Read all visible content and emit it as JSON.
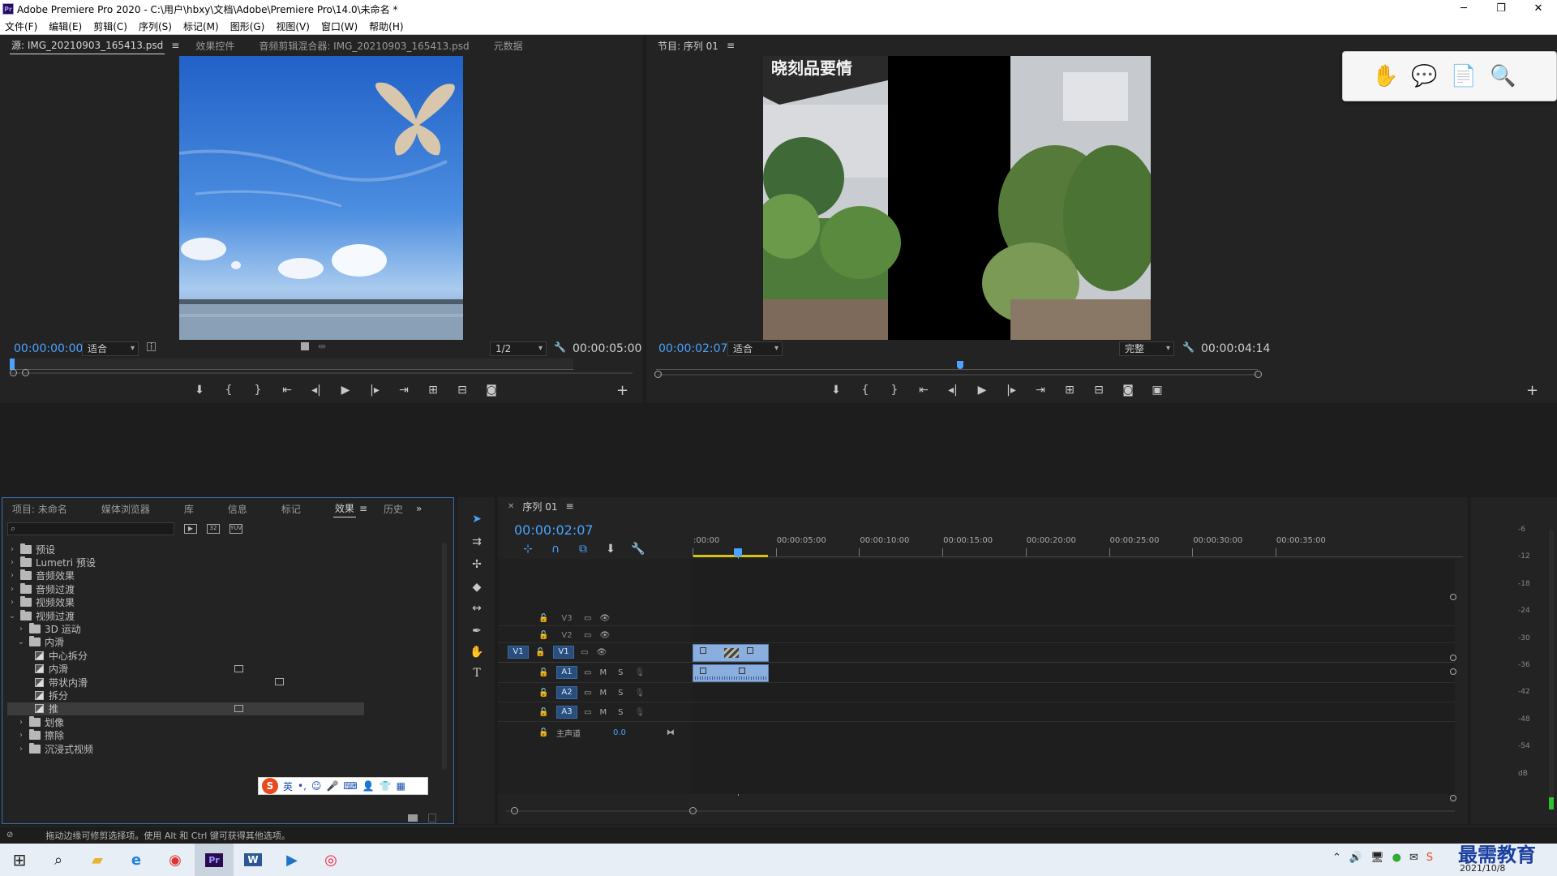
{
  "window": {
    "title": "Adobe Premiere Pro 2020 - C:\\用户\\hbxy\\文档\\Adobe\\Premiere Pro\\14.0\\未命名 *",
    "logo": "Pr"
  },
  "menu": [
    "文件(F)",
    "编辑(E)",
    "剪辑(C)",
    "序列(S)",
    "标记(M)",
    "图形(G)",
    "视图(V)",
    "窗口(W)",
    "帮助(H)"
  ],
  "source_panel": {
    "tabs": [
      "源: IMG_20210903_165413.psd",
      "效果控件",
      "音频剪辑混合器: IMG_20210903_165413.psd",
      "元数据"
    ],
    "timecode_in": "00:00:00:00",
    "fit": "适合",
    "resolution": "1/2",
    "duration": "00:00:05:00"
  },
  "program_panel": {
    "tab": "节目: 序列 01",
    "timecode": "00:00:02:07",
    "fit": "适合",
    "quality": "完整",
    "duration": "00:00:04:14",
    "playhead_fraction": 0.5
  },
  "project_panel": {
    "tabs": [
      "项目: 未命名",
      "媒体浏览器",
      "库",
      "信息",
      "标记",
      "效果",
      "历史"
    ],
    "active_tab": "效果",
    "tree": [
      {
        "label": "预设",
        "level": 0,
        "type": "folder",
        "expanded": false
      },
      {
        "label": "Lumetri 预设",
        "level": 0,
        "type": "folder",
        "expanded": false
      },
      {
        "label": "音频效果",
        "level": 0,
        "type": "folder",
        "expanded": false
      },
      {
        "label": "音频过渡",
        "level": 0,
        "type": "folder",
        "expanded": false
      },
      {
        "label": "视频效果",
        "level": 0,
        "type": "folder",
        "expanded": false
      },
      {
        "label": "视频过渡",
        "level": 0,
        "type": "folder",
        "expanded": true
      },
      {
        "label": "3D 运动",
        "level": 1,
        "type": "folder",
        "expanded": false
      },
      {
        "label": "内滑",
        "level": 1,
        "type": "folder",
        "expanded": true
      },
      {
        "label": "中心拆分",
        "level": 2,
        "type": "effect"
      },
      {
        "label": "内滑",
        "level": 2,
        "type": "effect"
      },
      {
        "label": "带状内滑",
        "level": 2,
        "type": "effect"
      },
      {
        "label": "拆分",
        "level": 2,
        "type": "effect"
      },
      {
        "label": "推",
        "level": 2,
        "type": "effect",
        "selected": true
      },
      {
        "label": "划像",
        "level": 1,
        "type": "folder",
        "expanded": false
      },
      {
        "label": "擦除",
        "level": 1,
        "type": "folder",
        "expanded": false
      },
      {
        "label": "沉浸式视频",
        "level": 1,
        "type": "folder",
        "expanded": false
      }
    ],
    "ime_label": "英"
  },
  "timeline": {
    "tab": "序列 01",
    "timecode": "00:00:02:07",
    "ruler": [
      ":00:00",
      "00:00:05:00",
      "00:00:10:00",
      "00:00:15:00",
      "00:00:20:00",
      "00:00:25:00",
      "00:00:30:00",
      "00:00:35:00"
    ],
    "video_tracks": [
      "V3",
      "V2",
      "V1"
    ],
    "audio_tracks": [
      "A1",
      "A2",
      "A3"
    ],
    "source_patch": "V1",
    "master_label": "主声道",
    "master_value": "0.0",
    "mute": "M",
    "solo": "S"
  },
  "meter": {
    "labels": [
      "-6",
      "-12",
      "-18",
      "-24",
      "-30",
      "-36",
      "-42",
      "-48",
      "-54",
      "dB"
    ]
  },
  "status": {
    "text": "拖动边缘可修剪选择项。使用 Alt 和 Ctrl 键可获得其他选项。"
  },
  "taskbar": {
    "date": "2021/10/8",
    "watermark": "最需教育"
  },
  "source_image": {
    "butterfly_color": "#d8c7ac"
  },
  "program_image": {
    "sign_text": "晓刻品要情"
  }
}
